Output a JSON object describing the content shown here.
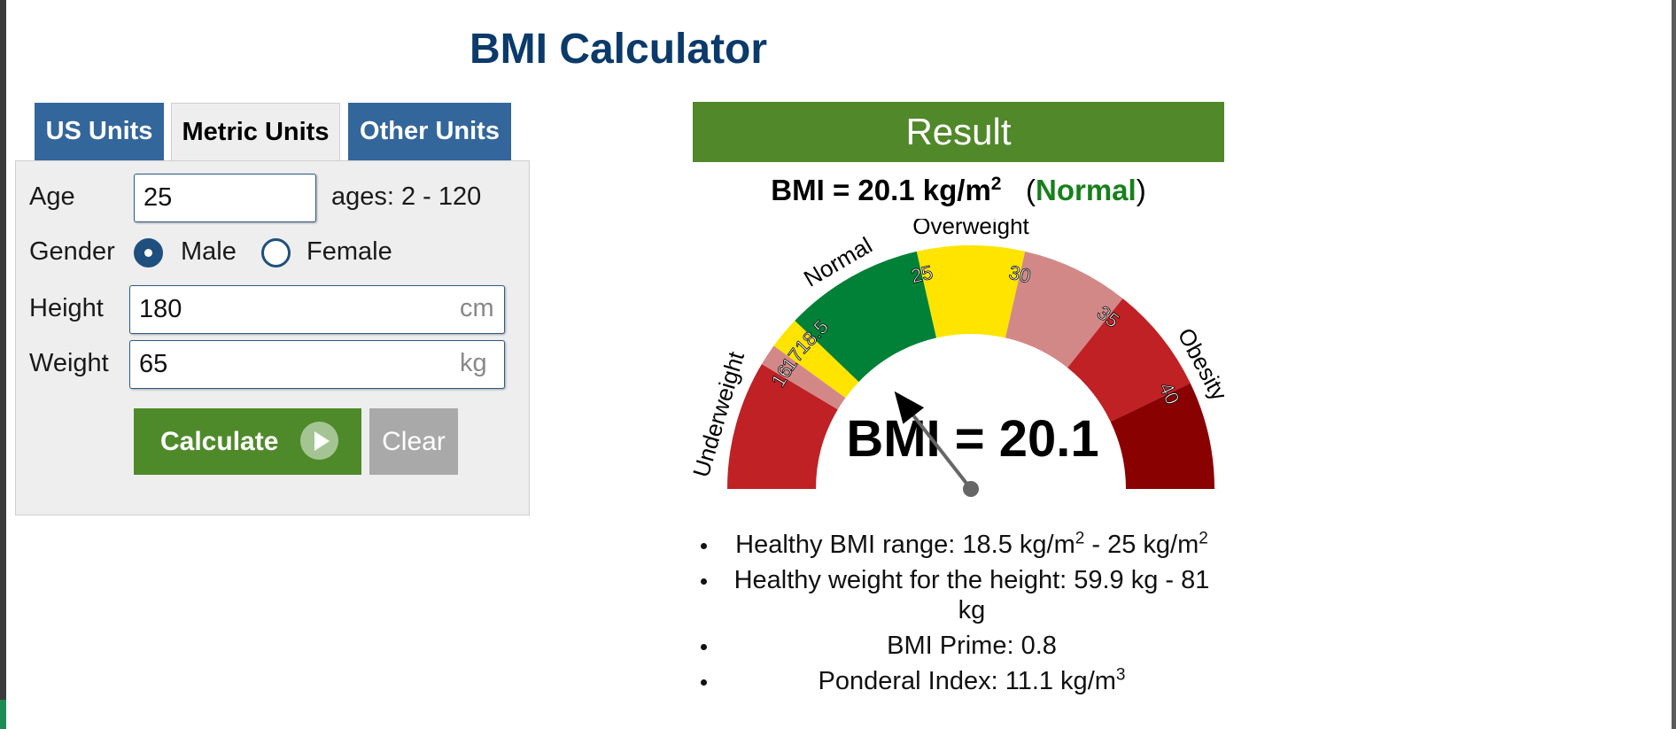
{
  "page_title": "BMI Calculator",
  "tabs": [
    {
      "label": "US Units",
      "active": false
    },
    {
      "label": "Metric Units",
      "active": true
    },
    {
      "label": "Other Units",
      "active": false
    }
  ],
  "form": {
    "age_label": "Age",
    "age_value": "25",
    "age_hint": "ages: 2 - 120",
    "gender_label": "Gender",
    "gender_options": [
      {
        "label": "Male",
        "checked": true
      },
      {
        "label": "Female",
        "checked": false
      }
    ],
    "height_label": "Height",
    "height_value": "180",
    "height_unit": "cm",
    "weight_label": "Weight",
    "weight_value": "65",
    "weight_unit": "kg",
    "calculate_label": "Calculate",
    "clear_label": "Clear"
  },
  "result": {
    "header": "Result",
    "bmi_prefix": "BMI = 20.1 kg/m",
    "bmi_exp": "2",
    "category_open": "(",
    "category": "Normal",
    "category_close": ")",
    "gauge": {
      "value": 20.1,
      "center_text": "BMI = 20.1",
      "range_min": 10,
      "range_max": 45,
      "segments": [
        {
          "from": 10,
          "to": 16,
          "color": "#bf2124"
        },
        {
          "from": 16,
          "to": 17,
          "color": "#d38888"
        },
        {
          "from": 17,
          "to": 18.5,
          "color": "#ffe400"
        },
        {
          "from": 18.5,
          "to": 25,
          "color": "#008137"
        },
        {
          "from": 25,
          "to": 30,
          "color": "#ffe400"
        },
        {
          "from": 30,
          "to": 35,
          "color": "#d38888"
        },
        {
          "from": 35,
          "to": 40,
          "color": "#bf2124"
        },
        {
          "from": 40,
          "to": 45,
          "color": "#8a0101"
        }
      ],
      "ticks": [
        {
          "value": 16,
          "label": "16"
        },
        {
          "value": 17,
          "label": "17"
        },
        {
          "value": 18.5,
          "label": "18.5"
        },
        {
          "value": 25,
          "label": "25"
        },
        {
          "value": 30,
          "label": "30"
        },
        {
          "value": 35,
          "label": "35"
        },
        {
          "value": 40,
          "label": "40"
        }
      ],
      "categories": [
        {
          "value": 13.2,
          "label": "Underweight"
        },
        {
          "value": 21.6,
          "label": "Normal"
        },
        {
          "value": 27.5,
          "label": "Overweight"
        },
        {
          "value": 39.5,
          "label": "Obesity"
        }
      ]
    },
    "items": [
      {
        "text": "Healthy BMI range: 18.5 kg/m",
        "exp1": "2",
        "mid": " - 25 kg/m",
        "exp2": "2"
      },
      {
        "text": "Healthy weight for the height: 59.9 kg - 81 kg"
      },
      {
        "text": "BMI Prime: 0.8"
      },
      {
        "text": "Ponderal Index: 11.1 kg/m",
        "exp1": "3"
      }
    ]
  }
}
